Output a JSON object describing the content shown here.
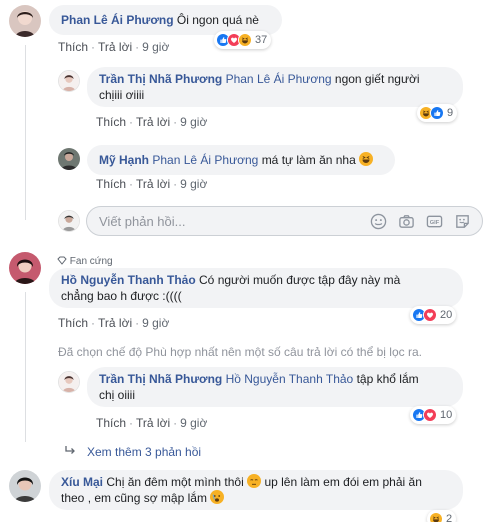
{
  "comments": [
    {
      "author": "Phan Lê Ái Phương",
      "text": "Ôi ngon quá nè",
      "actions": {
        "like": "Thích",
        "reply": "Trả lời",
        "time": "9 giờ"
      },
      "reactions_count": "37"
    },
    {
      "author": "Trần Thị Nhã Phương",
      "tag": "Phan Lê Ái Phương",
      "text_line1": "ngon giết người",
      "text_line2": "chịiii ơiiii",
      "actions": {
        "like": "Thích",
        "reply": "Trả lời",
        "time": "9 giờ"
      },
      "reactions_count": "9"
    },
    {
      "author": "Mỹ Hạnh",
      "tag": "Phan Lê Ái Phương",
      "text": "má tự làm ăn nha",
      "actions": {
        "like": "Thích",
        "reply": "Trả lời",
        "time": "9 giờ"
      }
    },
    {
      "badge": "Fan cứng",
      "author": "Hồ Nguyễn Thanh Thảo",
      "text_line1": "Có người muốn được tập đây này mà",
      "text_line2": "chẳng bao h được :((((",
      "actions": {
        "like": "Thích",
        "reply": "Trả lời",
        "time": "9 giờ"
      },
      "reactions_count": "20"
    },
    {
      "author": "Trần Thị Nhã Phương",
      "tag": "Hồ Nguyễn Thanh Thảo",
      "text_line1": "tập khổ lắm",
      "text_line2": "chị oiiii",
      "actions": {
        "like": "Thích",
        "reply": "Trả lời",
        "time": "9 giờ"
      },
      "reactions_count": "10"
    },
    {
      "author": "Xíu Mại",
      "text_line1a": "Chị ăn đêm một mình thôi",
      "text_line1b": "up lên làm em đói em phải ăn",
      "text_line2": "theo , em cũng sợ mập lắm",
      "reactions_count": "2"
    }
  ],
  "reply_input": {
    "placeholder": "Viết phản hồi..."
  },
  "filter_note": "Đã chọn chế độ Phù hợp nhất nên một số câu trả lời có thể bị lọc ra.",
  "see_more": "Xem thêm 3 phản hồi",
  "colors": {
    "link": "#385898",
    "bubble": "#f2f3f5",
    "like": "#1877f2",
    "love": "#f33e58",
    "haha": "#f7b125"
  },
  "icons": [
    "like-icon",
    "love-icon",
    "haha-icon",
    "emoji-icon",
    "camera-icon",
    "gif-icon",
    "sticker-icon",
    "diamond-icon",
    "reply-arrow-icon"
  ]
}
